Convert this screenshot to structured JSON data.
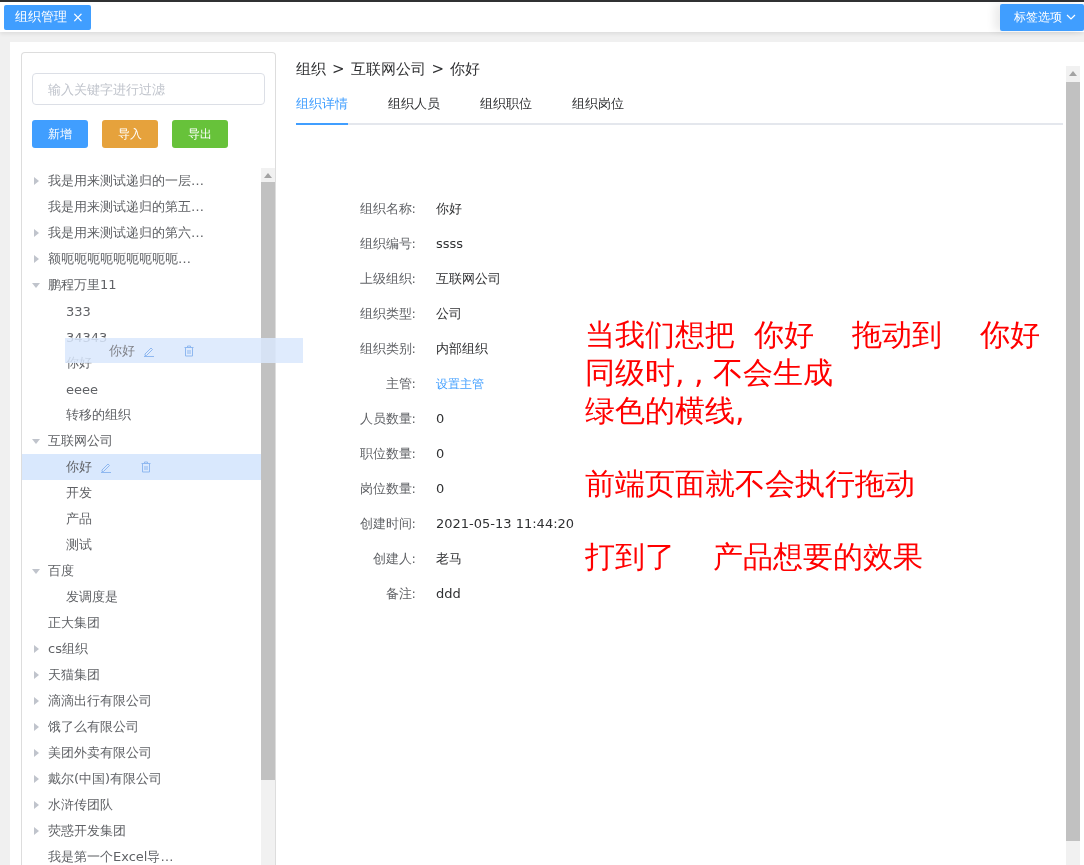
{
  "top_tabs": [
    {
      "label": "组织管理",
      "close": "×",
      "selected": true
    }
  ],
  "tab_options": {
    "label": "标签选项"
  },
  "filter": {
    "placeholder": "输入关键字进行过滤"
  },
  "buttons": [
    {
      "label": "新增",
      "kind": "primary"
    },
    {
      "label": "导入",
      "kind": "warning"
    },
    {
      "label": "导出",
      "kind": "success"
    }
  ],
  "tree": [
    {
      "label": "我是用来测试递归的一层…",
      "kind": "branch",
      "expanded": false,
      "selected": false
    },
    {
      "label": "我是用来测试递归的第五…",
      "kind": "leaf",
      "selected": false
    },
    {
      "label": "我是用来测试递归的第六…",
      "kind": "branch",
      "expanded": false,
      "selected": false
    },
    {
      "label": "额呃呃呃呃呃呃呃呃呃…",
      "kind": "branch",
      "expanded": false,
      "selected": false
    },
    {
      "label": "鹏程万里11",
      "kind": "branch",
      "expanded": true,
      "selected": false,
      "children": [
        {
          "label": "333",
          "kind": "leaf",
          "selected": false
        },
        {
          "label": "34343",
          "kind": "leaf",
          "selected": false
        },
        {
          "label": "你好",
          "kind": "leaf",
          "selected": false
        },
        {
          "label": "eeee",
          "kind": "leaf",
          "selected": false
        },
        {
          "label": "转移的组织",
          "kind": "leaf",
          "selected": false
        }
      ]
    },
    {
      "label": "互联网公司",
      "kind": "branch",
      "expanded": true,
      "selected": false,
      "children": [
        {
          "label": "你好",
          "kind": "leaf",
          "selected": true
        },
        {
          "label": "开发",
          "kind": "leaf",
          "selected": false
        },
        {
          "label": "产品",
          "kind": "leaf",
          "selected": false
        },
        {
          "label": "测试",
          "kind": "leaf",
          "selected": false
        }
      ]
    },
    {
      "label": "百度",
      "kind": "branch",
      "expanded": true,
      "selected": false,
      "children": [
        {
          "label": "发调度是",
          "kind": "leaf",
          "selected": false
        }
      ]
    },
    {
      "label": "正大集团",
      "kind": "leaf",
      "selected": false
    },
    {
      "label": "cs组织",
      "kind": "branch",
      "expanded": false,
      "selected": false
    },
    {
      "label": "天猫集团",
      "kind": "branch",
      "expanded": false,
      "selected": false
    },
    {
      "label": "滴滴出行有限公司",
      "kind": "branch",
      "expanded": false,
      "selected": false
    },
    {
      "label": "饿了么有限公司",
      "kind": "branch",
      "expanded": false,
      "selected": false
    },
    {
      "label": "美团外卖有限公司",
      "kind": "branch",
      "expanded": false,
      "selected": false
    },
    {
      "label": "戴尔(中国)有限公司",
      "kind": "branch",
      "expanded": false,
      "selected": false
    },
    {
      "label": "水浒传团队",
      "kind": "branch",
      "expanded": false,
      "selected": false
    },
    {
      "label": "荧惑开发集团",
      "kind": "branch",
      "expanded": false,
      "selected": false
    },
    {
      "label": "我是第一个Excel导…",
      "kind": "leaf",
      "selected": false
    }
  ],
  "drag_ghost": {
    "label": "你好"
  },
  "breadcrumb": [
    "组织",
    "互联网公司",
    "你好"
  ],
  "breadcrumb_separator": ">",
  "tabs": [
    {
      "label": "组织详情",
      "selected": true
    },
    {
      "label": "组织人员",
      "selected": false
    },
    {
      "label": "组织职位",
      "selected": false
    },
    {
      "label": "组织岗位",
      "selected": false
    }
  ],
  "details": [
    {
      "label": "组织名称:",
      "value": "你好",
      "kind": "text"
    },
    {
      "label": "组织编号:",
      "value": "ssss",
      "kind": "text"
    },
    {
      "label": "上级组织:",
      "value": "互联网公司",
      "kind": "text"
    },
    {
      "label": "组织类型:",
      "value": "公司",
      "kind": "text"
    },
    {
      "label": "组织类别:",
      "value": "内部组织",
      "kind": "text"
    },
    {
      "label": "主管:",
      "value": "设置主管",
      "kind": "link"
    },
    {
      "label": "人员数量:",
      "value": "0",
      "kind": "text"
    },
    {
      "label": "职位数量:",
      "value": "0",
      "kind": "text"
    },
    {
      "label": "岗位数量:",
      "value": "0",
      "kind": "text"
    },
    {
      "label": "创建时间:",
      "value": "2021-05-13 11:44:20",
      "kind": "text"
    },
    {
      "label": "创建人:",
      "value": "老马",
      "kind": "text"
    },
    {
      "label": "备注:",
      "value": "ddd",
      "kind": "text"
    }
  ],
  "annotation": [
    [
      "当我们想把  你好    拖动到    你好",
      "同级时, , 不会生成",
      "绿色的横线,"
    ],
    [
      "前端页面就不会执行拖动"
    ],
    [
      "打到了    产品想要的效果"
    ]
  ]
}
